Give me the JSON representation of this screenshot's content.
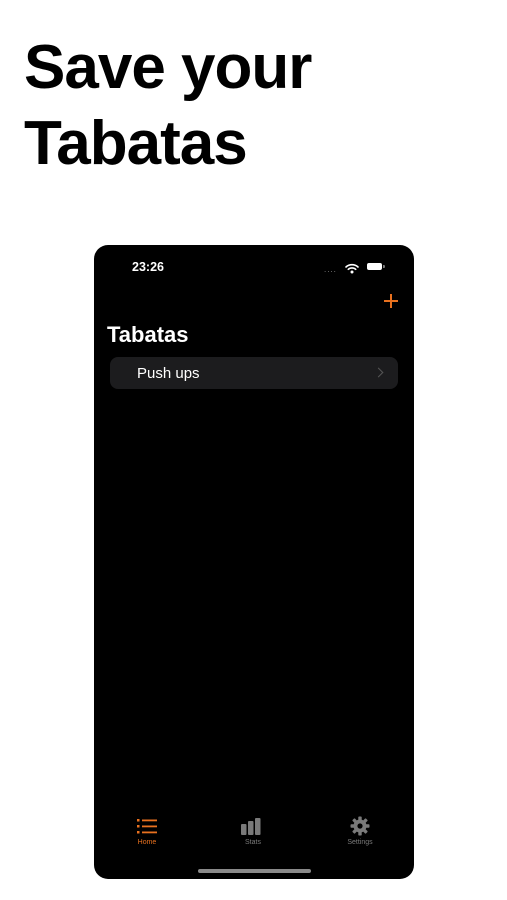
{
  "promo": {
    "line1": "Save your",
    "line2": "Tabatas"
  },
  "status_bar": {
    "time": "23:26",
    "signal": "....",
    "icons": [
      "wifi-icon",
      "battery-icon"
    ]
  },
  "nav": {
    "title": "Tabatas",
    "add_icon": "plus-icon",
    "accent_color": "#e8711f"
  },
  "list": {
    "items": [
      {
        "label": "Push ups"
      }
    ]
  },
  "tabbar": {
    "tabs": [
      {
        "label": "Home",
        "icon": "list-icon",
        "active": true
      },
      {
        "label": "Stats",
        "icon": "bar-chart-icon",
        "active": false
      },
      {
        "label": "Settings",
        "icon": "gear-icon",
        "active": false
      }
    ]
  }
}
